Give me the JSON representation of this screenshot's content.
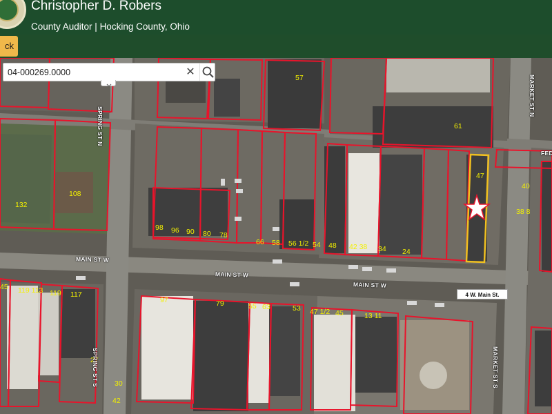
{
  "header": {
    "title": "Christopher D. Robers",
    "subtitle": "County Auditor | Hocking County, Ohio"
  },
  "back_button": {
    "label": "ck"
  },
  "search": {
    "value": "04-000269.0000",
    "clear_label": "✕"
  },
  "map": {
    "marker_label": "4 W. Main St.",
    "parcel_labels": [
      "57",
      "61",
      "47",
      "40",
      "38 8",
      "132",
      "108",
      "98",
      "96",
      "90",
      "80",
      "78",
      "66",
      "58",
      "56 1/2",
      "54",
      "48",
      "42 38",
      "34",
      "24",
      "45",
      "119 113",
      "119",
      "117",
      "27",
      "97",
      "79",
      "55",
      "63",
      "53",
      "47 1/2",
      "45",
      "13 11",
      "30",
      "42"
    ],
    "street_labels": [
      "SPRING ST N",
      "SPRING ST S",
      "MAIN ST W",
      "MAIN ST W",
      "MAIN ST W",
      "MARKET ST N",
      "MARKET ST S",
      "FED"
    ]
  },
  "colors": {
    "header_bg": "#1d4d2c",
    "back_button": "#f0b84a",
    "parcel_line": "#e8142b",
    "parcel_label": "#f3f000",
    "selected_parcel": "#f0c020"
  }
}
